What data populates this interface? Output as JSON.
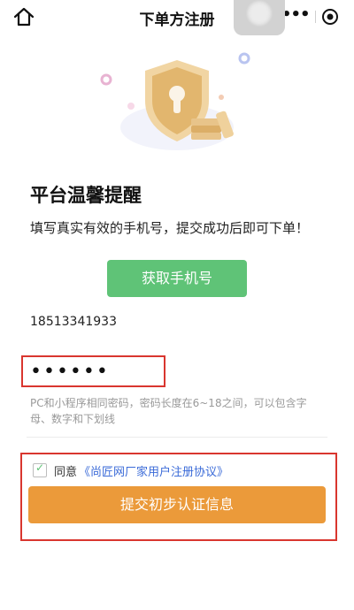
{
  "navbar": {
    "title": "下单方注册",
    "home_icon": "home-icon",
    "more_icon": "more-dots-icon",
    "close_icon": "mini-program-close-icon"
  },
  "hero": {
    "icon": "shield-lock-icon"
  },
  "notice": {
    "title": "平台温馨提醒",
    "tip": "填写真实有效的手机号，提交成功后即可下单！"
  },
  "phone": {
    "button_label": "获取手机号",
    "value": "18513341933"
  },
  "password": {
    "masked_value": "••••••",
    "hint": "PC和小程序相同密码，密码长度在6~18之间，可以包含字母、数字和下划线"
  },
  "agreement": {
    "checked": true,
    "check_glyph": "✓",
    "prefix": "同意",
    "link": "《尚匠网厂家用户注册协议》"
  },
  "submit": {
    "label": "提交初步认证信息"
  },
  "colors": {
    "primary_green": "#5fc377",
    "submit_orange": "#eb9a3a",
    "link_blue": "#3b6bd8",
    "highlight_red": "#d9362f"
  }
}
